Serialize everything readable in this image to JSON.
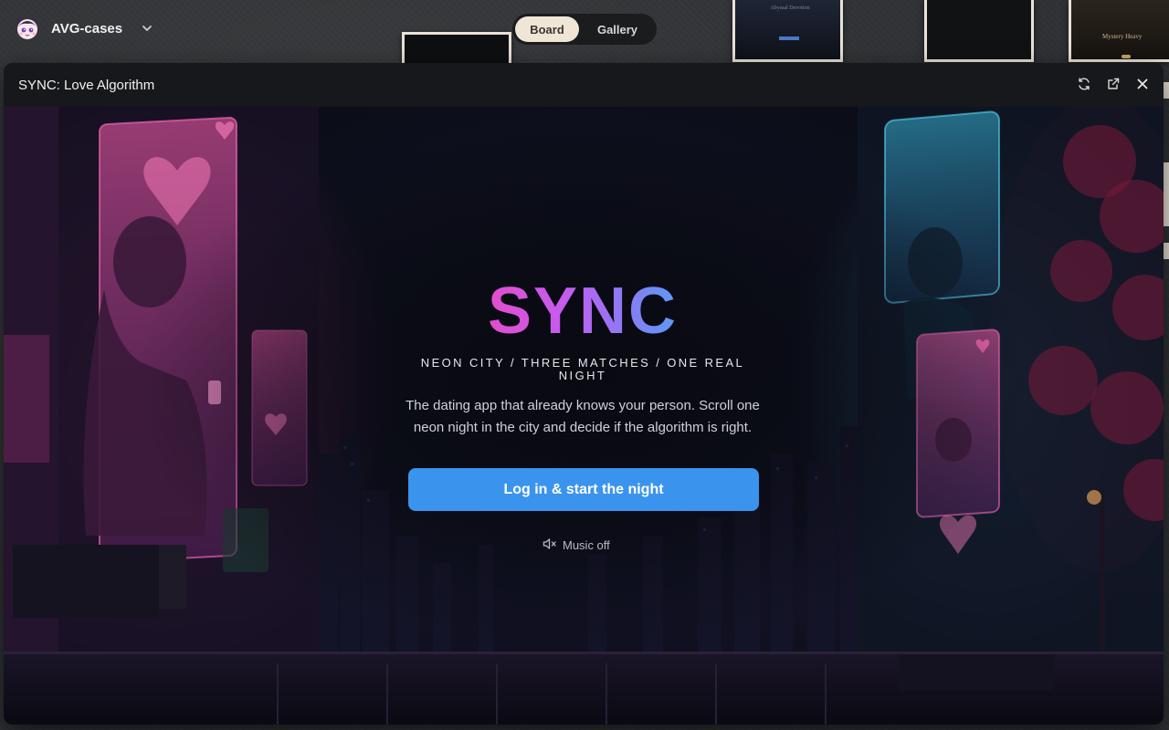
{
  "workspace": {
    "name": "AVG-cases"
  },
  "view_toggle": {
    "board": "Board",
    "gallery": "Gallery",
    "active": "Board"
  },
  "board_cards": {
    "card_b_text": "Abyssal Devotion",
    "card_d_text": "Mystery Heavy"
  },
  "modal": {
    "title": "SYNC: Love Algorithm",
    "actions": [
      "refresh-icon",
      "open-external-icon",
      "close-icon"
    ]
  },
  "app": {
    "logo": "SYNC",
    "tagline": "NEON CITY / THREE MATCHES / ONE REAL NIGHT",
    "description": "The dating app that already knows your person. Scroll one neon night in the city and decide if the algorithm is right.",
    "cta": "Log in & start the night",
    "music": "Music off"
  },
  "colors": {
    "accent": "#3a94ee",
    "logo_gradient": [
      "#ff3fa4",
      "#c65bf0",
      "#6e8cf5",
      "#2bd4ff"
    ],
    "neon_pink": "#ff4fa8",
    "neon_cyan": "#3fd6ff"
  }
}
